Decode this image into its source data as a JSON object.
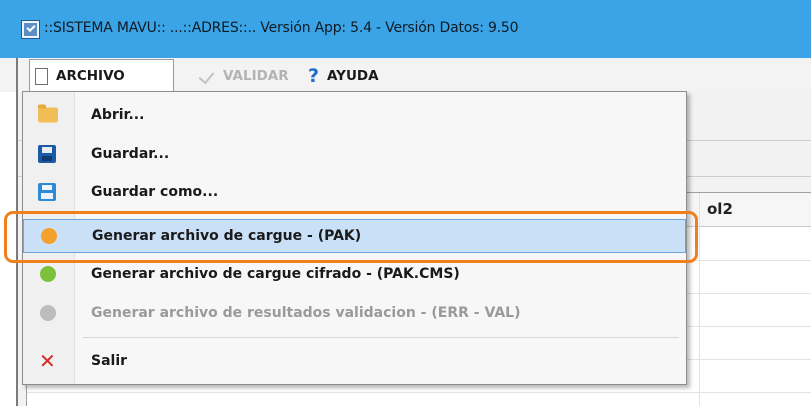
{
  "window": {
    "title": "::SISTEMA MAVU:: ...::ADRES::..  Versión App: 5.4  -  Versión Datos: 9.50"
  },
  "menubar": {
    "archivo": "ARCHIVO",
    "validar": "VALIDAR",
    "ayuda": "AYUDA",
    "ayuda_icon": "?"
  },
  "grid": {
    "visible_header_fragment": "ol2"
  },
  "dropdown": {
    "items": [
      {
        "label": "Abrir...",
        "icon": "folder-icon"
      },
      {
        "label": "Guardar...",
        "icon": "save-icon"
      },
      {
        "label": "Guardar como...",
        "icon": "save-as-icon"
      },
      {
        "label": "Generar archivo de cargue - (PAK)",
        "icon": "orange-dot-icon",
        "highlighted": true
      },
      {
        "label": "Generar archivo de cargue cifrado - (PAK.CMS)",
        "icon": "green-dot-icon"
      },
      {
        "label": "Generar archivo de resultados validacion - (ERR - VAL)",
        "icon": "gray-dot-icon",
        "disabled": true
      },
      {
        "label": "Salir",
        "icon": "close-icon"
      }
    ],
    "exit_icon": "✕"
  },
  "colors": {
    "titlebar": "#3aa4e6",
    "highlight": "#c9e0f7",
    "annotation": "#f07f1e",
    "orange_dot": "#f3a12a",
    "green_dot": "#7cc23b",
    "gray_dot": "#bdbdbd",
    "exit_red": "#d12b24"
  }
}
